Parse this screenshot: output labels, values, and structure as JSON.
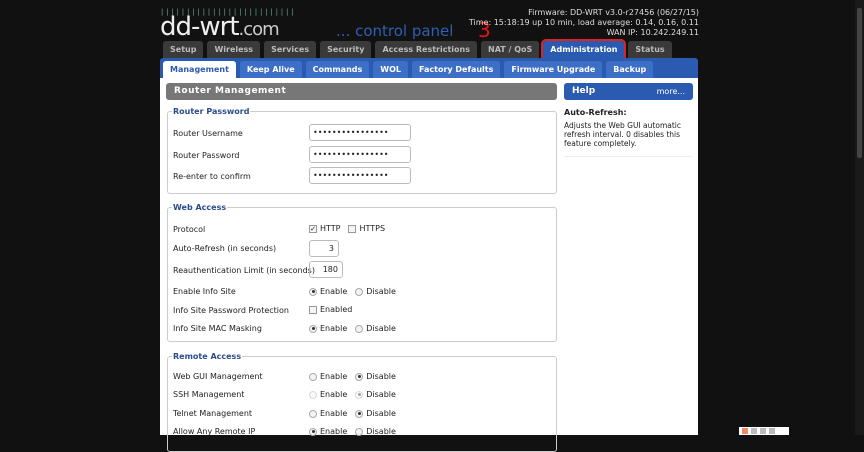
{
  "logo": {
    "text": "dd-wrt",
    "suffix": ".com",
    "tagline": "... control panel"
  },
  "annotation": "3",
  "info": {
    "firmware": "Firmware: DD-WRT v3.0-r27456 (06/27/15)",
    "time": "Time: 15:18:19 up 10 min, load average: 0.14, 0.16, 0.11",
    "wan": "WAN IP: 10.242.249.11"
  },
  "tabs": [
    "Setup",
    "Wireless",
    "Services",
    "Security",
    "Access Restrictions",
    "NAT / QoS",
    "Administration",
    "Status"
  ],
  "subtabs": [
    "Management",
    "Keep Alive",
    "Commands",
    "WOL",
    "Factory Defaults",
    "Firmware Upgrade",
    "Backup"
  ],
  "header": "Router Management",
  "help": {
    "title": "Help",
    "more": "more...",
    "topic": "Auto-Refresh:",
    "text": "Adjusts the Web GUI automatic refresh interval. 0 disables this feature completely."
  },
  "router_password": {
    "legend": "Router Password",
    "username_label": "Router Username",
    "username": "••••••••••••••••",
    "password_label": "Router Password",
    "password": "••••••••••••••••",
    "confirm_label": "Re-enter to confirm",
    "confirm": "••••••••••••••••"
  },
  "web_access": {
    "legend": "Web Access",
    "protocol_label": "Protocol",
    "http": "HTTP",
    "https": "HTTPS",
    "autorefresh_label": "Auto-Refresh (in seconds)",
    "autorefresh": "3",
    "reauth_label": "Reauthentication Limit (in seconds)",
    "reauth": "180",
    "infosite_label": "Enable Info Site",
    "infopw_label": "Info Site Password Protection",
    "enabled": "Enabled",
    "mac_label": "Info Site MAC Masking",
    "enable": "Enable",
    "disable": "Disable"
  },
  "remote_access": {
    "legend": "Remote Access",
    "webgui_label": "Web GUI Management",
    "ssh_label": "SSH Management",
    "telnet_label": "Telnet Management",
    "anyip_label": "Allow Any Remote IP"
  }
}
